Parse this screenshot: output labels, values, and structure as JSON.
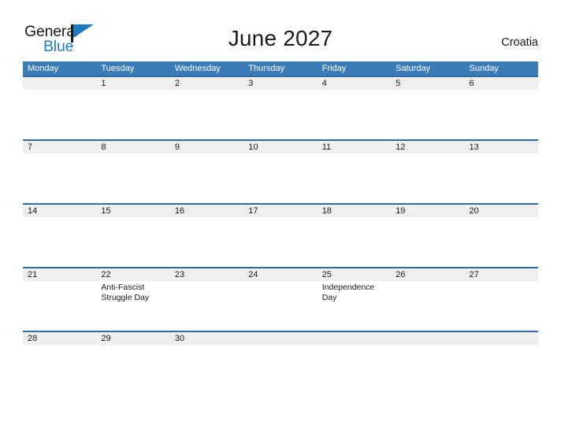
{
  "brand": {
    "word_one": "General",
    "word_two": "Blue",
    "flag_icon": "blue-triangle-flag-icon",
    "dark_color": "#1a1a1a",
    "blue_color": "#1f7bc1"
  },
  "header": {
    "title": "June 2027",
    "country": "Croatia"
  },
  "calendar": {
    "header_bg": "#3a7cb8",
    "rule_color": "#2e6da4",
    "band_bg": "#efefef",
    "day_names": [
      "Monday",
      "Tuesday",
      "Wednesday",
      "Thursday",
      "Friday",
      "Saturday",
      "Sunday"
    ],
    "weeks": [
      {
        "days": [
          {
            "num": "",
            "event": ""
          },
          {
            "num": "1",
            "event": ""
          },
          {
            "num": "2",
            "event": ""
          },
          {
            "num": "3",
            "event": ""
          },
          {
            "num": "4",
            "event": ""
          },
          {
            "num": "5",
            "event": ""
          },
          {
            "num": "6",
            "event": ""
          }
        ]
      },
      {
        "days": [
          {
            "num": "7",
            "event": ""
          },
          {
            "num": "8",
            "event": ""
          },
          {
            "num": "9",
            "event": ""
          },
          {
            "num": "10",
            "event": ""
          },
          {
            "num": "11",
            "event": ""
          },
          {
            "num": "12",
            "event": ""
          },
          {
            "num": "13",
            "event": ""
          }
        ]
      },
      {
        "days": [
          {
            "num": "14",
            "event": ""
          },
          {
            "num": "15",
            "event": ""
          },
          {
            "num": "16",
            "event": ""
          },
          {
            "num": "17",
            "event": ""
          },
          {
            "num": "18",
            "event": ""
          },
          {
            "num": "19",
            "event": ""
          },
          {
            "num": "20",
            "event": ""
          }
        ]
      },
      {
        "days": [
          {
            "num": "21",
            "event": ""
          },
          {
            "num": "22",
            "event": "Anti-Fascist\nStruggle Day"
          },
          {
            "num": "23",
            "event": ""
          },
          {
            "num": "24",
            "event": ""
          },
          {
            "num": "25",
            "event": "Independence Day"
          },
          {
            "num": "26",
            "event": ""
          },
          {
            "num": "27",
            "event": ""
          }
        ]
      },
      {
        "days": [
          {
            "num": "28",
            "event": ""
          },
          {
            "num": "29",
            "event": ""
          },
          {
            "num": "30",
            "event": ""
          },
          {
            "num": "",
            "event": ""
          },
          {
            "num": "",
            "event": ""
          },
          {
            "num": "",
            "event": ""
          },
          {
            "num": "",
            "event": ""
          }
        ]
      }
    ]
  }
}
